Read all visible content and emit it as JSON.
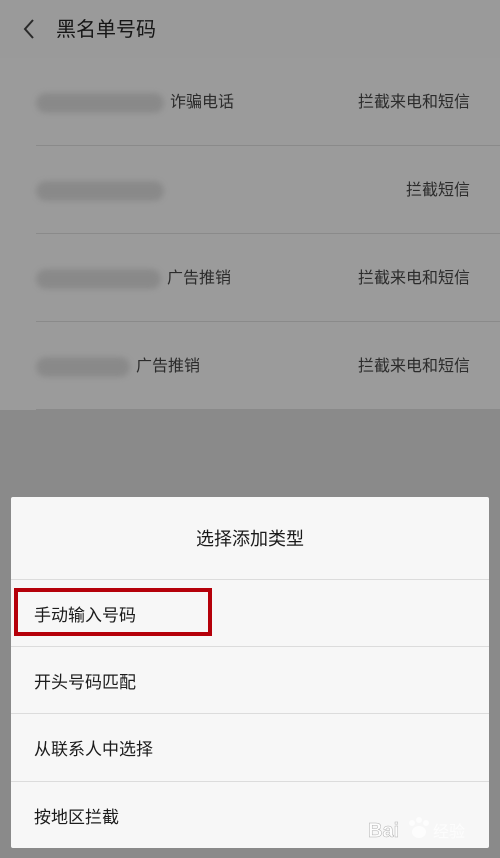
{
  "header": {
    "title": "黑名单号码"
  },
  "blacklist": [
    {
      "label": "诈骗电话",
      "mode": "拦截来电和短信"
    },
    {
      "label": "",
      "mode": "拦截短信"
    },
    {
      "label": "广告推销",
      "mode": "拦截来电和短信"
    },
    {
      "label": "广告推销",
      "mode": "拦截来电和短信"
    }
  ],
  "sheet": {
    "title": "选择添加类型",
    "options": [
      {
        "label": "手动输入号码"
      },
      {
        "label": "开头号码匹配"
      },
      {
        "label": "从联系人中选择"
      },
      {
        "label": "按地区拦截"
      }
    ]
  },
  "watermark": {
    "text": "Bai 经验"
  },
  "colors": {
    "highlight": "#b5000a"
  }
}
